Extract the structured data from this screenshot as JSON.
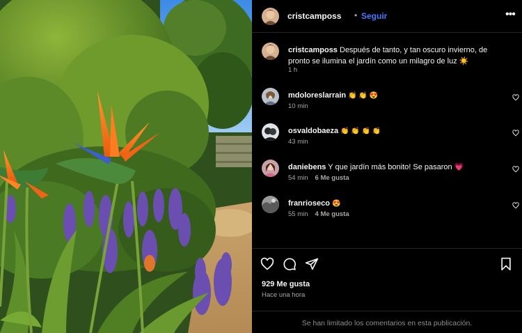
{
  "post": {
    "author": "cristcamposs",
    "follow_label": "Seguir",
    "separator": "•",
    "more_glyph": "•••",
    "caption_user": "cristcamposs",
    "caption_text": "Después de tanto, y tan oscuro invierno, de pronto se ilumina el jardín como un milagro de luz ☀️",
    "caption_time": "1 h",
    "likes": "929 Me gusta",
    "posted": "Hace una hora",
    "comments_limited": "Se han limitado los comentarios en esta publicación."
  },
  "comments": [
    {
      "user": "mdoloreslarrain",
      "text": "👏 👏 😍",
      "time": "10 min",
      "likes": ""
    },
    {
      "user": "osvaldobaeza",
      "text": "👏 👏 👏 👏",
      "time": "43 min",
      "likes": ""
    },
    {
      "user": "daniebens",
      "text": "Y que jardín más bonito! Se pasaron 💗",
      "time": "54 min",
      "likes": "6 Me gusta"
    },
    {
      "user": "franrioseco",
      "text": "😍",
      "time": "55 min",
      "likes": "4 Me gusta"
    }
  ],
  "icons": {
    "like": "heart-icon",
    "comment": "comment-icon",
    "share": "share-icon",
    "save": "bookmark-icon"
  },
  "colors": {
    "background": "#000000",
    "follow": "#4a7aff",
    "secondary_text": "#a8a8a8"
  }
}
